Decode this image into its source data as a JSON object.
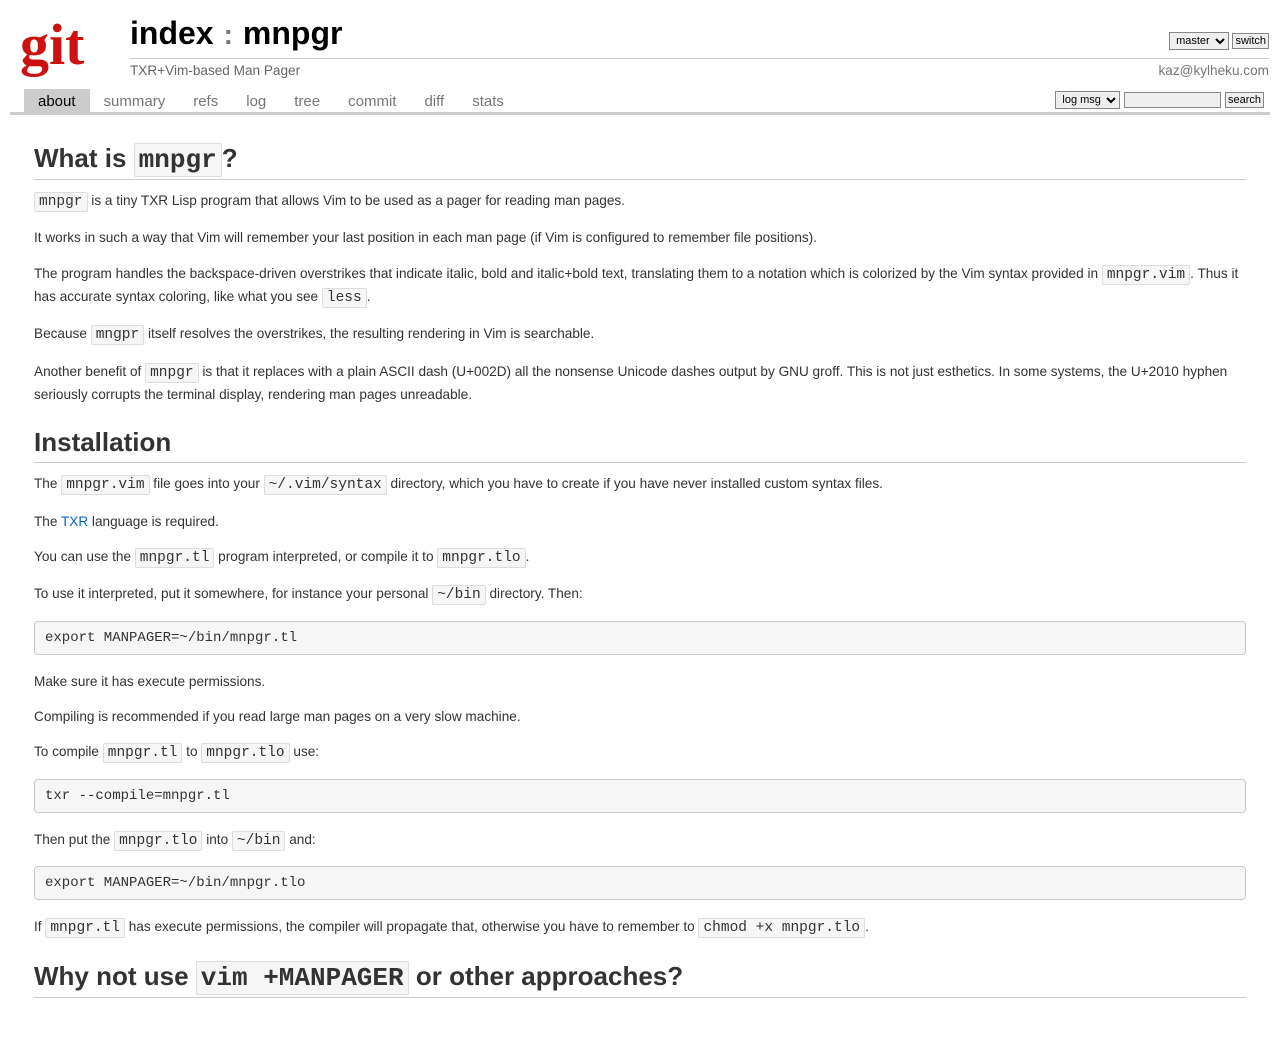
{
  "header": {
    "index_label": "index",
    "colon": ":",
    "repo": "mnpgr",
    "tagline": "TXR+Vim-based Man Pager",
    "author": "kaz@kylheku.com",
    "branch_options": [
      "master"
    ],
    "branch_selected": "master",
    "switch_label": "switch"
  },
  "tabs": {
    "items": [
      {
        "key": "about",
        "label": "about",
        "active": true
      },
      {
        "key": "summary",
        "label": "summary",
        "active": false
      },
      {
        "key": "refs",
        "label": "refs",
        "active": false
      },
      {
        "key": "log",
        "label": "log",
        "active": false
      },
      {
        "key": "tree",
        "label": "tree",
        "active": false
      },
      {
        "key": "commit",
        "label": "commit",
        "active": false
      },
      {
        "key": "diff",
        "label": "diff",
        "active": false
      },
      {
        "key": "stats",
        "label": "stats",
        "active": false
      }
    ]
  },
  "search": {
    "type_options": [
      "log msg"
    ],
    "type_selected": "log msg",
    "query": "",
    "button": "search"
  },
  "content": {
    "h1_pre": "What is ",
    "h1_code": "mnpgr",
    "h1_post": "?",
    "p1_code1": "mnpgr",
    "p1_text1": " is a tiny TXR Lisp program that allows Vim to be used as a pager for reading man pages.",
    "p2": "It works in such a way that Vim will remember your last position in each man page (if Vim is configured to remember file positions).",
    "p3_text1": "The program handles the backspace-driven overstrikes that indicate italic, bold and italic+bold text, translating them to a notation which is colorized by the Vim syntax provided in ",
    "p3_code1": "mnpgr.vim",
    "p3_text2": ". Thus it has accurate syntax coloring, like what you see ",
    "p3_code2": "less",
    "p3_text3": ".",
    "p4_text1": "Because ",
    "p4_code1": "mngpr",
    "p4_text2": " itself resolves the overstrikes, the resulting rendering in Vim is searchable.",
    "p5_text1": "Another benefit of ",
    "p5_code1": "mnpgr",
    "p5_text2": " is that it replaces with a plain ASCII dash (U+002D) all the nonsense Unicode dashes output by GNU groff. This is not just esthetics. In some systems, the U+2010 hyphen seriously corrupts the terminal display, rendering man pages unreadable.",
    "h2": "Installation",
    "p6_text1": "The ",
    "p6_code1": "mnpgr.vim",
    "p6_text2": " file goes into your ",
    "p6_code2": "~/.vim/syntax",
    "p6_text3": " directory, which you have to create if you have never installed custom syntax files.",
    "p7_text1": "The ",
    "p7_link": "TXR",
    "p7_text2": " language is required.",
    "p8_text1": "You can use the ",
    "p8_code1": "mnpgr.tl",
    "p8_text2": " program interpreted, or compile it to ",
    "p8_code2": "mnpgr.tlo",
    "p8_text3": ".",
    "p9_text1": "To use it interpreted, put it somewhere, for instance your personal ",
    "p9_code1": "~/bin",
    "p9_text2": " directory. Then:",
    "pre1": "export MANPAGER=~/bin/mnpgr.tl",
    "p10": "Make sure it has execute permissions.",
    "p11": "Compiling is recommended if you read large man pages on a very slow machine.",
    "p12_text1": "To compile ",
    "p12_code1": "mnpgr.tl",
    "p12_text2": " to ",
    "p12_code2": "mnpgr.tlo",
    "p12_text3": " use:",
    "pre2": "txr --compile=mnpgr.tl",
    "p13_text1": "Then put the ",
    "p13_code1": "mnpgr.tlo",
    "p13_text2": " into ",
    "p13_code2": "~/bin",
    "p13_text3": " and:",
    "pre3": "export MANPAGER=~/bin/mnpgr.tlo",
    "p14_text1": "If ",
    "p14_code1": "mnpgr.tl",
    "p14_text2": " has execute permissions, the compiler will propagate that, otherwise you have to remember to ",
    "p14_code2": "chmod +x mnpgr.tlo",
    "p14_text3": ".",
    "h3_pre": "Why not use ",
    "h3_code": "vim +MANPAGER",
    "h3_post": " or other approaches?"
  }
}
